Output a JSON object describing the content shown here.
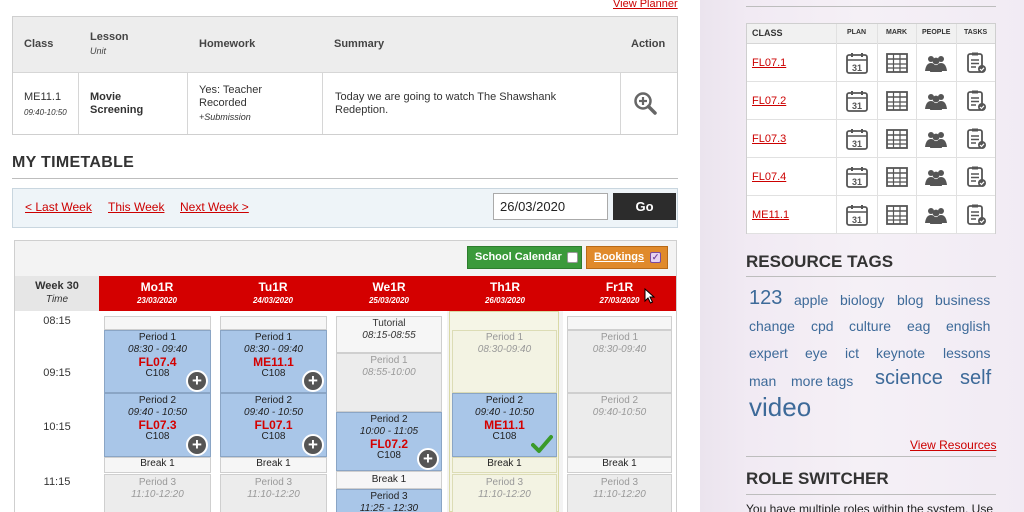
{
  "lesson_table": {
    "view_planner": "View Planner",
    "headers": {
      "class": "Class",
      "lesson": "Lesson",
      "unit": "Unit",
      "homework": "Homework",
      "summary": "Summary",
      "action": "Action"
    },
    "row": {
      "class": "ME11.1",
      "time": "09:40-10:50",
      "lesson_line1": "Movie",
      "lesson_line2": "Screening",
      "homework_line1": "Yes: Teacher",
      "homework_line2": "Recorded",
      "submission": "+Submission",
      "summary_line1": "Today we are going to watch The Shawshank",
      "summary_line2": "Redeption.",
      "action_icon": "zoom-in-icon"
    }
  },
  "timetable": {
    "title": "MY TIMETABLE",
    "nav": {
      "last_week": "< Last Week",
      "this_week": "This Week",
      "next_week": "Next Week >"
    },
    "date_value": "26/03/2020",
    "go_label": "Go",
    "school_calendar_label": "School Calendar",
    "bookings_label": "Bookings",
    "week_label": "Week 30",
    "time_label": "Time",
    "times": [
      "08:15",
      "09:15",
      "10:15",
      "11:15"
    ],
    "days": [
      {
        "name": "Mo1R",
        "date": "23/03/2020"
      },
      {
        "name": "Tu1R",
        "date": "24/03/2020"
      },
      {
        "name": "We1R",
        "date": "25/03/2020"
      },
      {
        "name": "Th1R",
        "date": "26/03/2020"
      },
      {
        "name": "Fr1R",
        "date": "27/03/2020"
      }
    ],
    "mon": {
      "p1": {
        "period": "Period 1",
        "time": "08:30 - 09:40",
        "code": "FL07.4",
        "room": "C108"
      },
      "p2": {
        "period": "Period 2",
        "time": "09:40 - 10:50",
        "code": "FL07.3",
        "room": "C108"
      },
      "break": "Break 1",
      "p3": {
        "period": "Period 3",
        "time": "11:10-12:20"
      }
    },
    "tue": {
      "p1": {
        "period": "Period 1",
        "time": "08:30 - 09:40",
        "code": "ME11.1",
        "room": "C108"
      },
      "p2": {
        "period": "Period 2",
        "time": "09:40 - 10:50",
        "code": "FL07.1",
        "room": "C108"
      },
      "break": "Break 1",
      "p3": {
        "period": "Period 3",
        "time": "11:10-12:20"
      }
    },
    "wed": {
      "tutorial": {
        "period": "Tutorial",
        "time": "08:15-08:55"
      },
      "p1": {
        "period": "Period 1",
        "time": "08:55-10:00"
      },
      "p2": {
        "period": "Period 2",
        "time": "10:00 - 11:05",
        "code": "FL07.2",
        "room": "C108"
      },
      "break": "Break 1",
      "p3": {
        "period": "Period 3",
        "time": "11:25 - 12:30"
      }
    },
    "thu": {
      "p1": {
        "period": "Period 1",
        "time": "08:30-09:40"
      },
      "p2": {
        "period": "Period 2",
        "time": "09:40 - 10:50",
        "code": "ME11.1",
        "room": "C108"
      },
      "break": "Break 1",
      "p3": {
        "period": "Period 3",
        "time": "11:10-12:20"
      }
    },
    "fri": {
      "p1": {
        "period": "Period 1",
        "time": "08:30-09:40"
      },
      "p2": {
        "period": "Period 2",
        "time": "09:40-10:50"
      },
      "break": "Break 1",
      "p3": {
        "period": "Period 3",
        "time": "11:10-12:20"
      }
    }
  },
  "my_classes": {
    "headers": {
      "class": "CLASS",
      "plan": "PLAN",
      "mark": "MARK",
      "people": "PEOPLE",
      "tasks": "TASKS"
    },
    "calendar_day": "31",
    "rows": [
      {
        "name": "FL07.1"
      },
      {
        "name": "FL07.2"
      },
      {
        "name": "FL07.3"
      },
      {
        "name": "FL07.4"
      },
      {
        "name": "ME11.1"
      }
    ]
  },
  "resource_tags": {
    "title": "RESOURCE TAGS",
    "tags": [
      "123",
      "apple",
      "biology",
      "blog",
      "business",
      "change",
      "cpd",
      "culture",
      "eag",
      "english",
      "expert",
      "eye",
      "ict",
      "keynote",
      "lessons",
      "man",
      "more tags",
      "science",
      "self",
      "video"
    ],
    "view_resources": "View Resources"
  },
  "role_switcher": {
    "title": "ROLE SWITCHER",
    "text": "You have multiple roles within the system. Use"
  },
  "colors": {
    "accent_red": "#d40000",
    "lesson_blue": "#a9c6e8",
    "calendar_green": "#3b9a3b",
    "bookings_orange": "#e08a2b",
    "tag_blue": "#3d6a99"
  }
}
